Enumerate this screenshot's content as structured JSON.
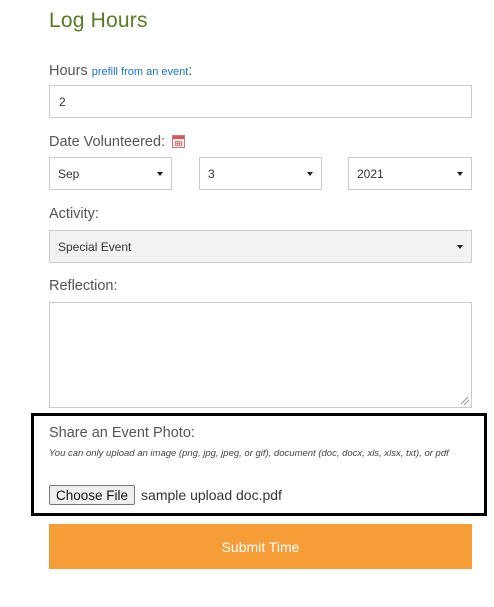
{
  "page": {
    "title": "Log Hours"
  },
  "hours": {
    "label": "Hours",
    "prefill_link": "prefill from an event",
    "colon": ":",
    "value": "2"
  },
  "date": {
    "label": "Date Volunteered:",
    "icon": "calendar-icon",
    "month": "Sep",
    "day": "3",
    "year": "2021"
  },
  "activity": {
    "label": "Activity:",
    "value": "Special Event"
  },
  "reflection": {
    "label": "Reflection:",
    "value": ""
  },
  "photo": {
    "label": "Share an Event Photo:",
    "note": "You can only upload an image (png, jpg, jpeg, or gif), document (doc, docx, xls, xlsx, txt), or pdf",
    "choose_button": "Choose File",
    "file_name": "sample upload doc.pdf"
  },
  "submit": {
    "label": "Submit Time",
    "color": "#f79d37"
  },
  "colors": {
    "heading": "#5a7a2a",
    "link": "#1a73c9"
  }
}
